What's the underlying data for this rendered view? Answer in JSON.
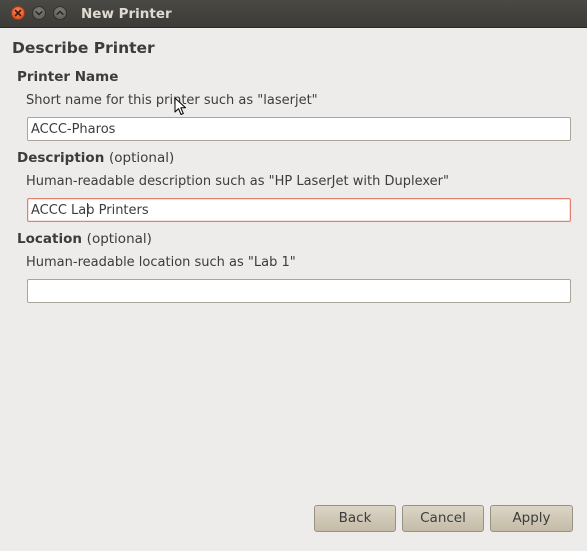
{
  "window": {
    "title": "New Printer",
    "controls": [
      "close-icon",
      "minimize-icon",
      "maximize-icon"
    ]
  },
  "page": {
    "heading": "Describe Printer"
  },
  "printer_name": {
    "label": "Printer Name",
    "hint": "Short name for this printer such as \"laserjet\"",
    "value": "ACCC-Pharos"
  },
  "description": {
    "label": "Description",
    "optional": "(optional)",
    "hint": "Human-readable description such as \"HP LaserJet with Duplexer\"",
    "value": "ACCC Lab Printers"
  },
  "location": {
    "label": "Location",
    "optional": "(optional)",
    "hint": "Human-readable location such as \"Lab 1\"",
    "value": ""
  },
  "buttons": {
    "back": "Back",
    "cancel": "Cancel",
    "apply": "Apply"
  },
  "colors": {
    "accent_close": "#df4a16",
    "window_bg": "#edeceb",
    "titlebar": "#3c3b37",
    "focus_border": "#e08070"
  }
}
